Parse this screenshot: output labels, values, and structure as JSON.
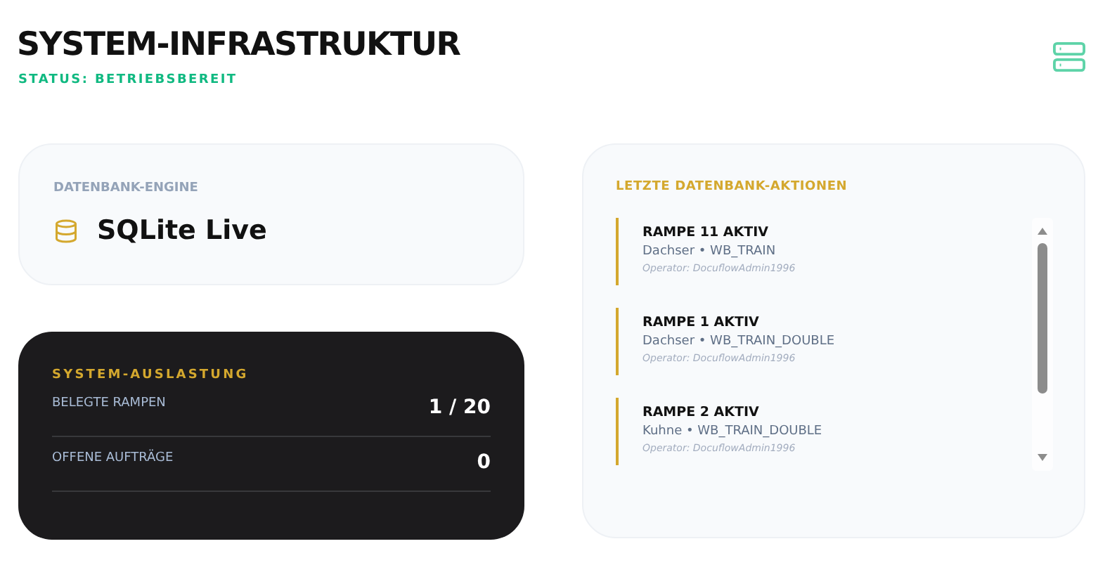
{
  "header": {
    "title": "SYSTEM-INFRASTRUKTUR",
    "status": "STATUS: BETRIEBSBEREIT"
  },
  "engine": {
    "label": "DATENBANK-ENGINE",
    "value": "SQLite Live"
  },
  "load": {
    "title": "SYSTEM-AUSLASTUNG",
    "rows": [
      {
        "label": "BELEGTE RAMPEN",
        "value": "1 / 20"
      },
      {
        "label": "OFFENE AUFTRÄGE",
        "value": "0"
      }
    ]
  },
  "actions": {
    "title": "LETZTE DATENBANK-AKTIONEN",
    "items": [
      {
        "title": "RAMPE 11 AKTIV",
        "detail": "Dachser • WB_TRAIN",
        "operator": "Operator: DocuflowAdmin1996"
      },
      {
        "title": "RAMPE 1 AKTIV",
        "detail": "Dachser • WB_TRAIN_DOUBLE",
        "operator": "Operator: DocuflowAdmin1996"
      },
      {
        "title": "RAMPE 2 AKTIV",
        "detail": "Kuhne • WB_TRAIN_DOUBLE",
        "operator": "Operator: DocuflowAdmin1996"
      }
    ]
  }
}
